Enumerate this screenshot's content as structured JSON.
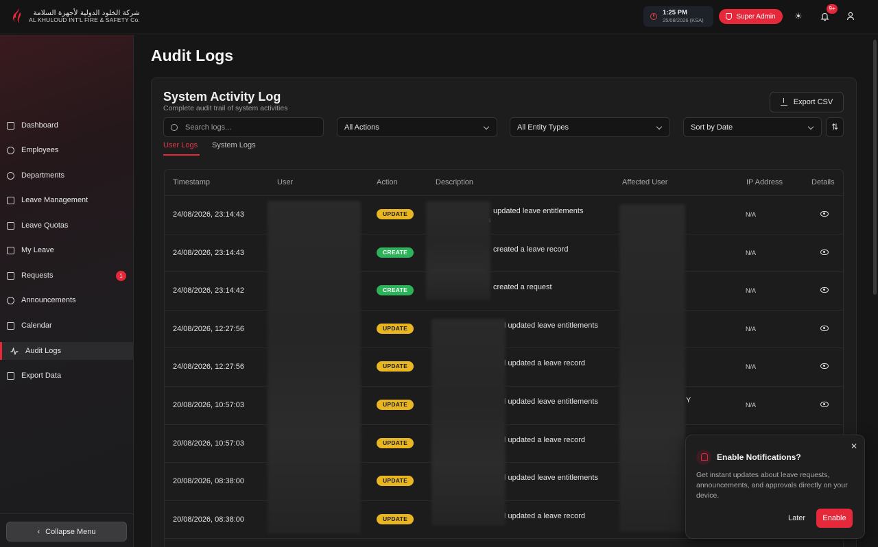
{
  "brand": {
    "arabic_name": "شركة الخلود الدولية لأجهزة السلامة",
    "english_name": "AL KHULOUD INT'L FIRE & SAFETY Co."
  },
  "topbar": {
    "time": "1:25 PM",
    "date": "25/08/2026 (KSA)",
    "role_badge": "Super Admin",
    "notification_count": "9+",
    "colors": {
      "accent": "#e5283a",
      "background": "#141414"
    }
  },
  "sidebar": {
    "items": [
      {
        "label": "Dashboard",
        "icon": "grid-icon"
      },
      {
        "label": "Employees",
        "icon": "users-icon"
      },
      {
        "label": "Departments",
        "icon": "database-icon"
      },
      {
        "label": "Leave Management",
        "icon": "calendar-icon"
      },
      {
        "label": "Leave Quotas",
        "icon": "calendar-clock-icon"
      },
      {
        "label": "My Leave",
        "icon": "calendar-icon"
      },
      {
        "label": "Requests",
        "icon": "clipboard-icon",
        "badge": "1"
      },
      {
        "label": "Announcements",
        "icon": "bell-icon"
      },
      {
        "label": "Calendar",
        "icon": "calendar-clock-icon"
      },
      {
        "label": "Audit Logs",
        "icon": "activity-icon",
        "active": true
      },
      {
        "label": "Export Data",
        "icon": "download-icon"
      }
    ],
    "collapse_label": "Collapse Menu"
  },
  "page": {
    "title": "Audit Logs",
    "card_title": "System Activity Log",
    "card_subtitle": "Complete audit trail of system activities",
    "export_label": "Export CSV",
    "search_placeholder": "Search logs...",
    "filter_actions": "All Actions",
    "filter_entities": "All Entity Types",
    "sort": "Sort by Date",
    "tabs": [
      "User Logs",
      "System Logs"
    ]
  },
  "table": {
    "headers": [
      "Timestamp",
      "User",
      "Action",
      "Description",
      "Affected User",
      "IP Address",
      "Details"
    ],
    "rows": [
      {
        "timestamp": "24/08/2026, 23:14:43",
        "action": "UPDATE",
        "description": "updated leave entitlements",
        "desc_sub": "s",
        "ip": "N/A"
      },
      {
        "timestamp": "24/08/2026, 23:14:43",
        "action": "CREATE",
        "description": "created a leave record",
        "ip": "N/A"
      },
      {
        "timestamp": "24/08/2026, 23:14:42",
        "action": "CREATE",
        "description": "created a request",
        "ip": "N/A"
      },
      {
        "timestamp": "24/08/2026, 12:27:56",
        "action": "UPDATE",
        "description": "l updated leave entitlements",
        "ip": "N/A"
      },
      {
        "timestamp": "24/08/2026, 12:27:56",
        "action": "UPDATE",
        "description": "l updated a leave record",
        "ip": "N/A"
      },
      {
        "timestamp": "20/08/2026, 10:57:03",
        "action": "UPDATE",
        "description": "l updated leave entitlements",
        "affected_extra": "Y",
        "ip": "N/A"
      },
      {
        "timestamp": "20/08/2026, 10:57:03",
        "action": "UPDATE",
        "description": "l updated a leave record"
      },
      {
        "timestamp": "20/08/2026, 08:38:00",
        "action": "UPDATE",
        "description": "l updated leave entitlements"
      },
      {
        "timestamp": "20/08/2026, 08:38:00",
        "action": "UPDATE",
        "description": "l updated a leave record"
      }
    ]
  },
  "notification_popup": {
    "title": "Enable Notifications?",
    "text": "Get instant updates about leave requests, announcements, and approvals directly on your device.",
    "later_label": "Later",
    "enable_label": "Enable",
    "close_glyph": "✕"
  }
}
